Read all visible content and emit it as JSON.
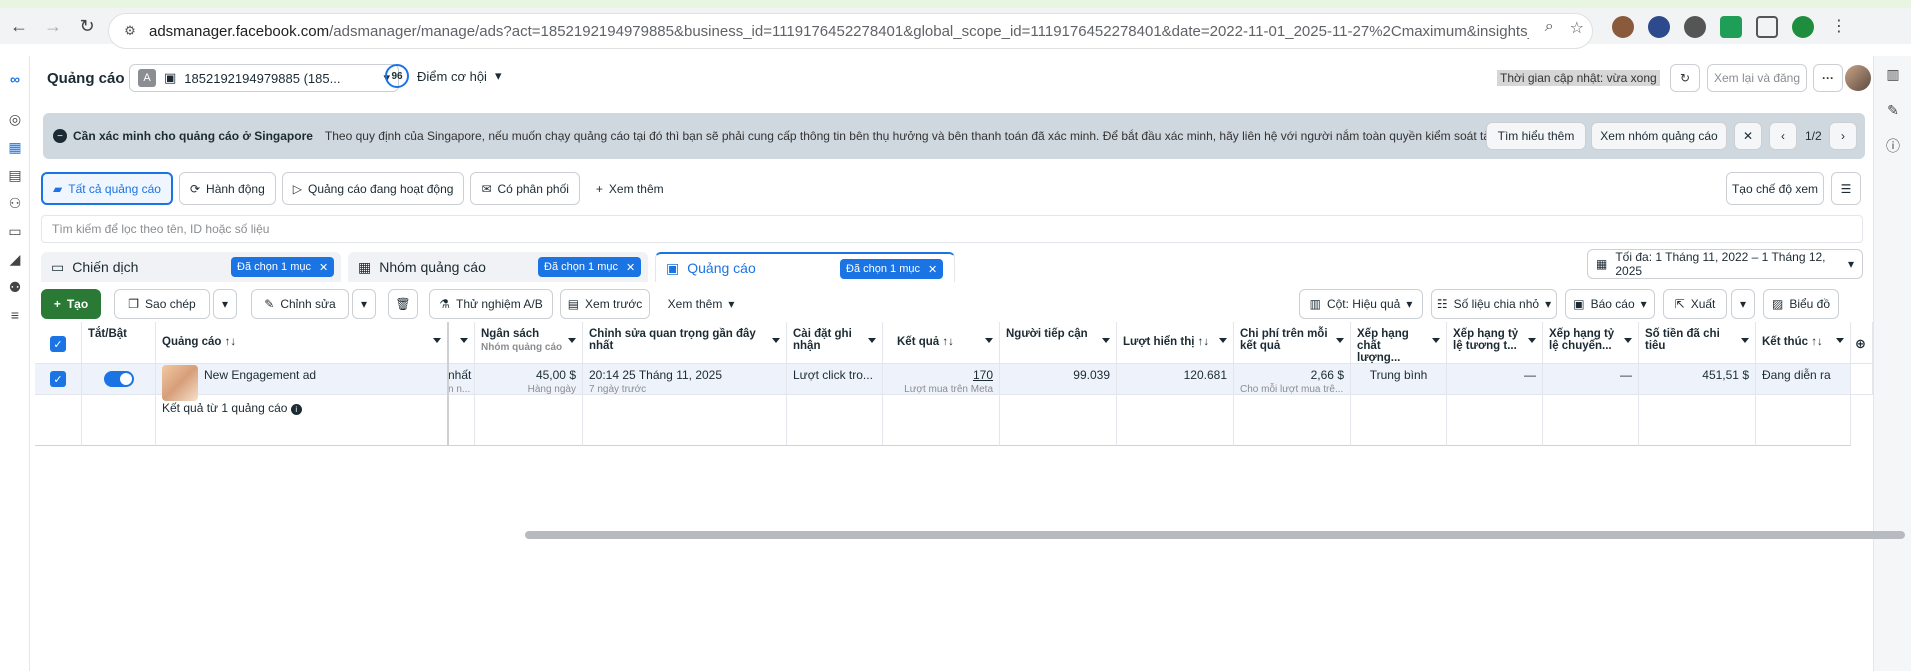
{
  "browser": {
    "url_host": "adsmanager.facebook.com",
    "url_rest": "/adsmanager/manage/ads?act=1852192194979885&business_id=1119176452278401&global_scope_id=1119176452278401&date=2022-11-01_2025-11-27%2Cmaximum&insights_date=2022-10-2..."
  },
  "topbar": {
    "title": "Quảng cáo",
    "account_badge": "A",
    "account_id": "1852192194979885 (185...",
    "score_value": "96",
    "score_label": "Điểm cơ hội",
    "update_time": "Thời gian cập nhật: vừa xong",
    "review_publish": "Xem lại và đăng",
    "more": "···"
  },
  "banner": {
    "title": "Cần xác minh cho quảng cáo ở Singapore",
    "text": "Theo quy định của Singapore, nếu muốn chạy quảng cáo tại đó thì bạn sẽ phải cung cấp thông tin bên thụ hưởng và bên thanh toán đã xác minh. Để bắt đầu xác minh, hãy liên hệ với người nắm toàn quyền kiểm soát tài khoản quả...",
    "learn_more": "Tìm hiểu thêm",
    "view_adsets": "Xem nhóm quảng cáo",
    "pager": "1/2"
  },
  "filters": {
    "all_ads": "Tất cả quảng cáo",
    "actions": "Hành động",
    "active_ads": "Quảng cáo đang hoạt động",
    "delivery": "Có phân phối",
    "see_more": "Xem thêm",
    "custom_view": "Tạo chế độ xem"
  },
  "search": {
    "placeholder": "Tìm kiếm để lọc theo tên, ID hoặc số liệu"
  },
  "levels": {
    "campaigns": "Chiến dịch",
    "adsets": "Nhóm quảng cáo",
    "ads": "Quảng cáo",
    "chip": "Đã chọn 1 mục"
  },
  "daterange": "Tối đa: 1 Tháng 11, 2022 – 1 Tháng 12, 2025",
  "toolbar": {
    "create": "Tạo",
    "duplicate": "Sao chép",
    "edit": "Chỉnh sửa",
    "ab_test": "Thử nghiệm A/B",
    "preview": "Xem trước",
    "see_more": "Xem thêm",
    "columns": "Cột: Hiệu quả",
    "breakdown": "Số liệu chia nhỏ",
    "reports": "Báo cáo",
    "export": "Xuất",
    "charts": "Biểu đồ"
  },
  "table": {
    "headers": {
      "toggle": "Tắt/Bật",
      "ad_name": "Quảng cáo",
      "budget": "Ngân sách",
      "budget_sub": "Nhóm quảng cáo",
      "last_edit": "Chỉnh sửa quan trọng gần đây nhất",
      "attribution": "Cài đặt ghi nhận",
      "results": "Kết quả",
      "reach": "Người tiếp cận",
      "impressions": "Lượt hiển thị",
      "cost_per_result": "Chi phí trên mỗi kết quả",
      "quality": "Xếp hạng chất lượng...",
      "engagement_rank": "Xếp hạng tỷ lệ tương t...",
      "conversion_rank": "Xếp hạng tỷ lệ chuyển...",
      "spent": "Số tiền đã chi tiêu",
      "ends": "Kết thúc"
    },
    "row": {
      "name": "New Engagement ad",
      "partial_left": "nhất",
      "partial_left_sub": "n n...",
      "budget": "45,00 $",
      "budget_sub": "Hàng ngày",
      "last_edit": "20:14 25 Tháng 11, 2025",
      "last_edit_sub": "7 ngày trước",
      "attribution": "Lượt click tro...",
      "results": "170",
      "results_sub": "Lượt mua trên Meta",
      "reach": "99.039",
      "impressions": "120.681",
      "cost_per_result": "2,66 $",
      "cost_sub": "Cho mỗi lượt mua trê...",
      "quality": "Trung bình",
      "engagement_rank": "—",
      "conversion_rank": "—",
      "spent": "451,51 $",
      "ends": "Đang diễn ra"
    },
    "summary": "Kết quả từ 1 quảng cáo"
  }
}
